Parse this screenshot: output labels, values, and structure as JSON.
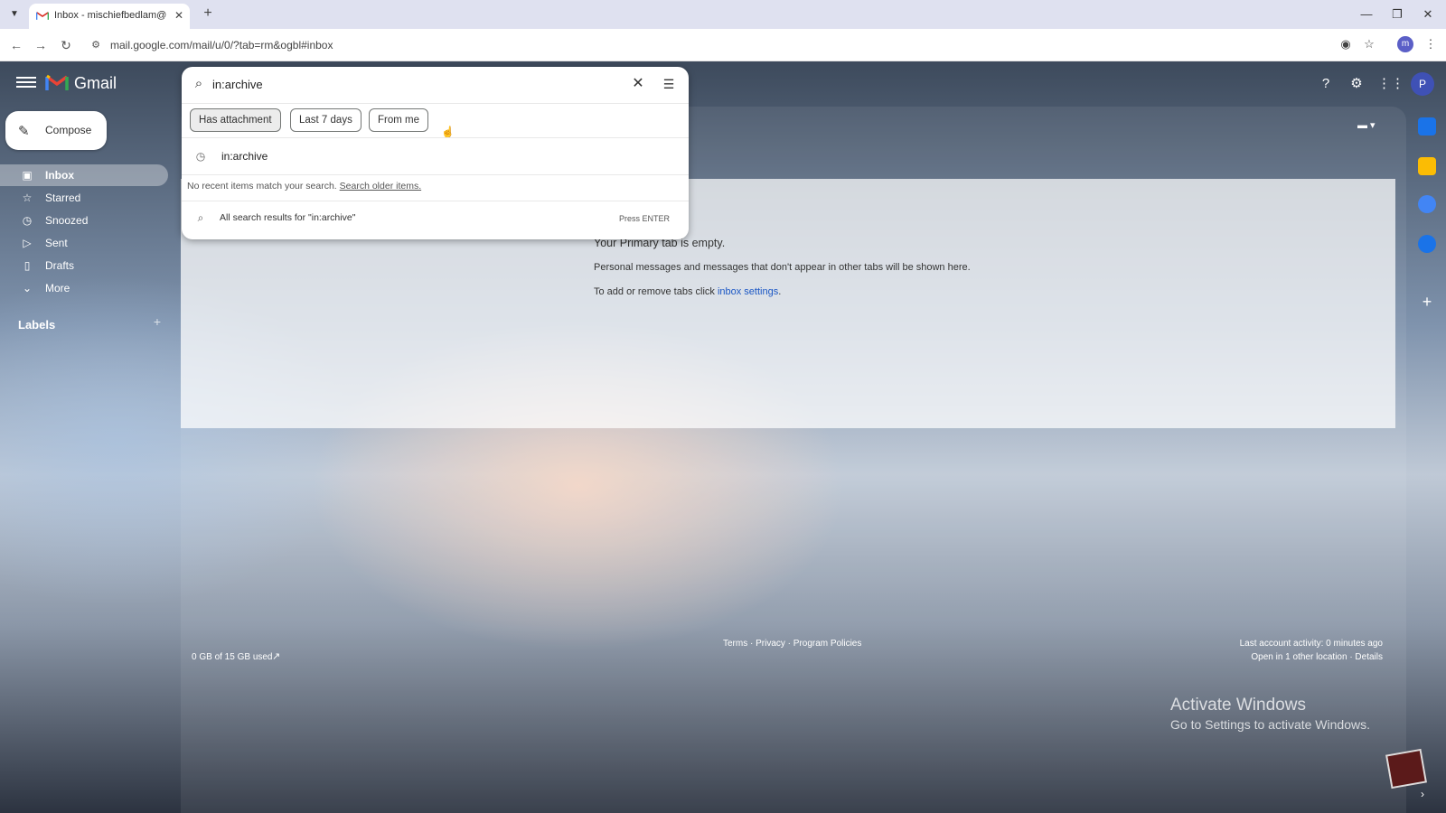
{
  "browser": {
    "tab_title": "Inbox - mischiefbedlam@gmail",
    "url": "mail.google.com/mail/u/0/?tab=rm&ogbl#inbox",
    "profile_initial": "m"
  },
  "gmail": {
    "logo_text": "Gmail",
    "compose_label": "Compose",
    "nav": [
      {
        "label": "Inbox",
        "icon": "inbox-icon"
      },
      {
        "label": "Starred",
        "icon": "star-icon"
      },
      {
        "label": "Snoozed",
        "icon": "clock-icon"
      },
      {
        "label": "Sent",
        "icon": "send-icon"
      },
      {
        "label": "Drafts",
        "icon": "draft-icon"
      },
      {
        "label": "More",
        "icon": "chevron-down-icon"
      }
    ],
    "labels_heading": "Labels",
    "avatar_initial": "P"
  },
  "search": {
    "query": "in:archive",
    "chips": [
      "Has attachment",
      "Last 7 days",
      "From me"
    ],
    "history_item": "in:archive",
    "no_match_text": "No recent items match your search.",
    "search_older_link": "Search older items.",
    "all_results_text": "All search results for \"in:archive\"",
    "press_enter": "Press ENTER"
  },
  "empty_state": {
    "title": "Your Primary tab is empty.",
    "description": "Personal messages and messages that don't appear in other tabs will be shown here.",
    "tabs_prefix": "To add or remove tabs click",
    "tabs_link": "inbox settings",
    "tabs_suffix": "."
  },
  "footer": {
    "storage": "0 GB of 15 GB used",
    "links": "Terms · Privacy · Program Policies",
    "last_activity": "Last account activity: 0 minutes ago",
    "location": "Open in 1 other location · Details"
  },
  "watermark": {
    "line1": "Activate Windows",
    "line2": "Go to Settings to activate Windows."
  },
  "colors": {
    "accent": "#1a56c4",
    "avatar": "#3f51b5"
  }
}
